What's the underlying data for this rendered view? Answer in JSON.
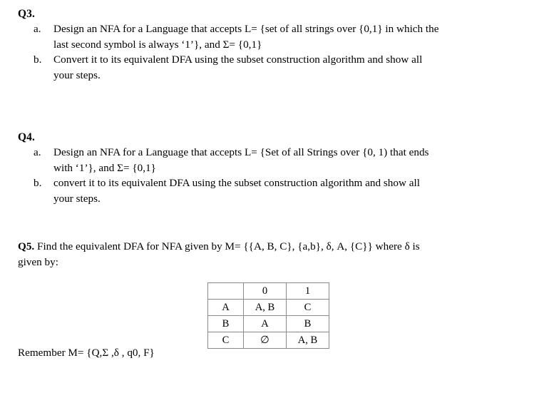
{
  "document": {
    "background_color": "#ffffff",
    "text_color": "#000000",
    "table_border_color": "#8a8a8a"
  },
  "questions": [
    {
      "label": "Q3.",
      "items": [
        {
          "marker": "a.",
          "lines": [
            "Design an NFA for a Language that accepts L= {set of all strings over {0,1} in which the",
            "last second symbol is always ‘1’}, and Σ= {0,1}"
          ]
        },
        {
          "marker": "b.",
          "lines": [
            "Convert it to its equivalent DFA using the subset construction algorithm and show all",
            "your steps."
          ]
        }
      ]
    },
    {
      "label": "Q4.",
      "items": [
        {
          "marker": "a.",
          "lines": [
            "Design an NFA for a Language that accepts L= {Set of all Strings over {0, 1) that ends",
            "with ‘1’}, and Σ= {0,1}"
          ]
        },
        {
          "marker": "b.",
          "lines": [
            "convert it to its equivalent DFA using the subset construction algorithm and show all",
            "your steps."
          ]
        }
      ]
    }
  ],
  "q5": {
    "label": "Q5.",
    "line1": " Find the equivalent DFA for NFA given by M= {{A, B, C}, {a,b}, δ, A, {C}} where δ is",
    "line2": "given by:"
  },
  "transition_table": {
    "corner": "",
    "headers": [
      "0",
      "1"
    ],
    "rows": [
      {
        "state": "A",
        "cells": [
          "A, B",
          "C"
        ]
      },
      {
        "state": "B",
        "cells": [
          "A",
          "B"
        ]
      },
      {
        "state": "C",
        "cells": [
          "∅",
          "A, B"
        ]
      }
    ]
  },
  "footer_note": "Remember M= {Q,Σ ,δ , q0, F}"
}
